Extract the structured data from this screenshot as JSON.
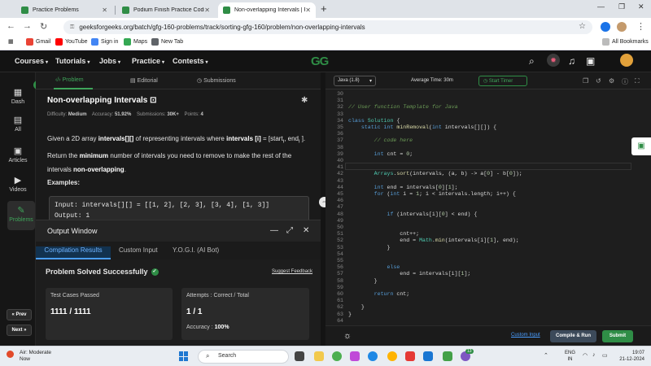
{
  "browser": {
    "tabs": [
      {
        "label": "Practice Problems",
        "favicon": "GG",
        "color": "#2f8d46"
      },
      {
        "label": "Podium Finish Practice Coding",
        "favicon": "GG",
        "color": "#2f8d46"
      },
      {
        "label": "Non-overlapping Intervals | Pra",
        "favicon": "GG",
        "color": "#2f8d46",
        "active": true
      }
    ],
    "new_tab_icon": "+",
    "url": "geeksforgeeks.org/batch/gfg-160-problems/track/sorting-gfg-160/problem/non-overlapping-intervals",
    "bookmarks": [
      {
        "label": "Gmail",
        "color": "#ea4335"
      },
      {
        "label": "YouTube",
        "color": "#ff0000"
      },
      {
        "label": "Sign in",
        "color": "#4285f4"
      },
      {
        "label": "Maps",
        "color": "#34a853"
      },
      {
        "label": "New Tab",
        "color": "#5f6368"
      }
    ],
    "all_bookmarks": "All Bookmarks"
  },
  "site": {
    "nav": [
      "Courses",
      "Tutorials",
      "Jobs",
      "Practice",
      "Contests"
    ],
    "logo": "GG"
  },
  "sidebar": {
    "items": [
      {
        "label": "Dash",
        "icon": "dashboard-icon",
        "glyph": "▦"
      },
      {
        "label": "All",
        "icon": "all-icon",
        "glyph": "▤"
      },
      {
        "label": "Articles",
        "icon": "articles-icon",
        "glyph": "▣"
      },
      {
        "label": "Videos",
        "icon": "videos-icon",
        "glyph": "▶"
      },
      {
        "label": "Problems",
        "icon": "problems-icon",
        "glyph": "✎",
        "active": true
      }
    ],
    "prev": "« Prev",
    "next": "Next »"
  },
  "problem_tabs": [
    "Problem",
    "Editorial",
    "Submissions"
  ],
  "problem": {
    "title": "Non-overlapping Intervals",
    "difficulty_label": "Difficulty:",
    "difficulty": "Medium",
    "accuracy_label": "Accuracy:",
    "accuracy": "51.92%",
    "submissions_label": "Submissions:",
    "submissions": "30K+",
    "points_label": "Points:",
    "points": "4",
    "examples_label": "Examples:",
    "example_input": "Input:  intervals[][] = [[1, 2], [2, 3], [3, 4], [1, 3]]",
    "example_output": "Output:  1"
  },
  "output": {
    "title": "Output Window",
    "tabs": [
      "Compilation Results",
      "Custom Input",
      "Y.O.G.I. (AI Bot)"
    ],
    "status": "Problem Solved Successfully",
    "feedback": "Suggest Feedback",
    "cases_label": "Test Cases Passed",
    "cases_value": "1111 / 1111",
    "attempts_label": "Attempts : Correct / Total",
    "attempts_value": "1 / 1",
    "accuracy_label": "Accuracy :",
    "accuracy_value": "100%"
  },
  "editor": {
    "language": "Java (1.8)",
    "average_time": "Average Time: 30m",
    "start_timer": "Start Timer",
    "custom_input": "Custom Input",
    "compile": "Compile & Run",
    "submit": "Submit",
    "lines": [
      {
        "n": "30",
        "t": ""
      },
      {
        "n": "31",
        "t": ""
      },
      {
        "n": "32",
        "t": "// User function Template for Java",
        "c": "cm"
      },
      {
        "n": "33",
        "t": ""
      },
      {
        "n": "34",
        "t": "class Solution {"
      },
      {
        "n": "35",
        "t": "    static int minRemoval(int intervals[][]) {"
      },
      {
        "n": "36",
        "t": ""
      },
      {
        "n": "37",
        "t": "        // code here",
        "c": "cm"
      },
      {
        "n": "38",
        "t": ""
      },
      {
        "n": "39",
        "t": "        int cnt = 0;"
      },
      {
        "n": "40",
        "t": ""
      },
      {
        "n": "41",
        "t": ""
      },
      {
        "n": "42",
        "t": "        Arrays.sort(intervals, (a, b) -> a[0] - b[0]);"
      },
      {
        "n": "43",
        "t": ""
      },
      {
        "n": "44",
        "t": "        int end = intervals[0][1];"
      },
      {
        "n": "45",
        "t": "        for (int i = 1; i < intervals.length; i++) {"
      },
      {
        "n": "46",
        "t": ""
      },
      {
        "n": "47",
        "t": ""
      },
      {
        "n": "48",
        "t": "            if (intervals[i][0] < end) {"
      },
      {
        "n": "49",
        "t": ""
      },
      {
        "n": "50",
        "t": ""
      },
      {
        "n": "51",
        "t": "                cnt++;"
      },
      {
        "n": "52",
        "t": "                end = Math.min(intervals[i][1], end);"
      },
      {
        "n": "53",
        "t": "            }"
      },
      {
        "n": "54",
        "t": ""
      },
      {
        "n": "55",
        "t": ""
      },
      {
        "n": "56",
        "t": "            else"
      },
      {
        "n": "57",
        "t": "                end = intervals[i][1];"
      },
      {
        "n": "58",
        "t": "        }"
      },
      {
        "n": "59",
        "t": ""
      },
      {
        "n": "60",
        "t": "        return cnt;"
      },
      {
        "n": "61",
        "t": ""
      },
      {
        "n": "62",
        "t": "    }"
      },
      {
        "n": "63",
        "t": "}"
      },
      {
        "n": "64",
        "t": ""
      }
    ]
  },
  "taskbar": {
    "weather_temp": "",
    "weather_label": "Air: Moderate",
    "weather_sub": "Now",
    "search": "Search",
    "lang1": "ENG",
    "lang2": "IN",
    "time": "19:07",
    "date": "21-12-2024",
    "badge": "13"
  }
}
